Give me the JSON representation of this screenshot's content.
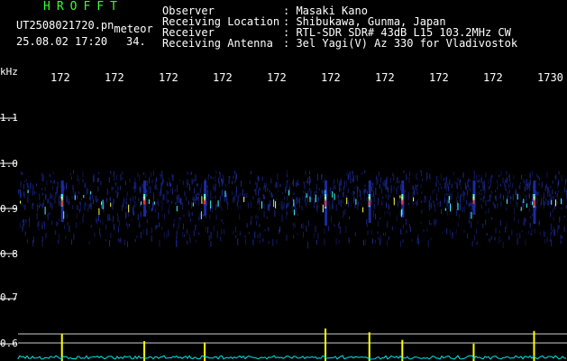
{
  "header": {
    "brand": "HROFFT",
    "filename": "UT2508021720.pn",
    "filename_suffix": "meteor",
    "datetime": "25.08.02 17:20",
    "count": "34.",
    "fields": [
      {
        "label": "Observer",
        "value": ": Masaki Kano"
      },
      {
        "label": "Receiving Location",
        "value": ": Shibukawa, Gunma, Japan"
      },
      {
        "label": "Receiver",
        "value": ": RTL-SDR SDR# 43dB L15 103.2MHz CW"
      },
      {
        "label": "Receiving Antenna",
        "value": ": 3el Yagi(V) Az 330 for Vladivostok"
      }
    ]
  },
  "time_axis": {
    "ticks": [
      "172",
      "172",
      "172",
      "172",
      "172",
      "172",
      "172",
      "172",
      "172",
      "1730"
    ]
  },
  "freq_axis": {
    "unit": "kHz",
    "labels": [
      "1.1",
      "1.0",
      "0.9",
      "0.8",
      "0.7",
      "0.6"
    ]
  },
  "colors": {
    "background": "#000000",
    "noise": "#1b2a9a",
    "signal_hot": "#ff3030",
    "signal_warm": "#ffff40",
    "signal_cool": "#40ffff",
    "power_trace": "#00e6e6",
    "power_peaks": "#ffff00",
    "brand_green": "#33ff33"
  },
  "events": [
    {
      "minute_frac": 0.08,
      "strength": 0.8
    },
    {
      "minute_frac": 0.23,
      "strength": 0.5
    },
    {
      "minute_frac": 0.34,
      "strength": 0.45
    },
    {
      "minute_frac": 0.56,
      "strength": 1.0
    },
    {
      "minute_frac": 0.64,
      "strength": 0.85
    },
    {
      "minute_frac": 0.7,
      "strength": 0.55
    },
    {
      "minute_frac": 0.83,
      "strength": 0.4
    },
    {
      "minute_frac": 0.94,
      "strength": 0.9
    }
  ]
}
